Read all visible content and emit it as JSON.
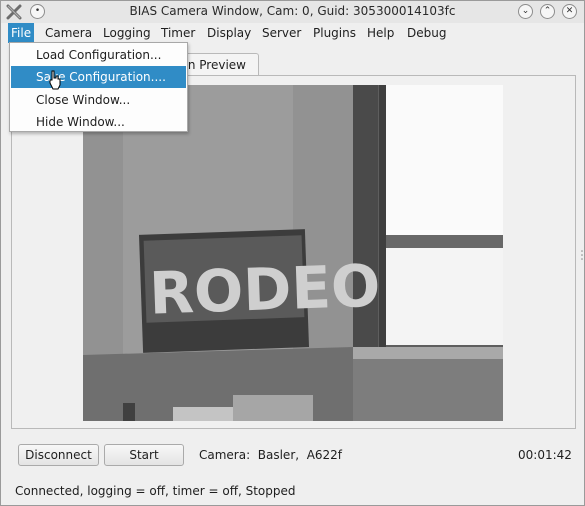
{
  "window": {
    "title": "BIAS Camera Window, Cam: 0, Guid: 305300014103fc",
    "icon": "tools-x-icon",
    "controls": [
      "minimize-icon",
      "maximize-icon",
      "close-icon"
    ]
  },
  "menubar": {
    "items": [
      {
        "label": "File",
        "active": true
      },
      {
        "label": "Camera"
      },
      {
        "label": "Logging"
      },
      {
        "label": "Timer"
      },
      {
        "label": "Display"
      },
      {
        "label": "Server"
      },
      {
        "label": "Plugins"
      },
      {
        "label": "Help"
      },
      {
        "label": "Debug"
      }
    ]
  },
  "file_menu": {
    "items": [
      {
        "label": "Load Configuration...",
        "selected": false
      },
      {
        "label": "Save Configuration....",
        "selected": true
      },
      {
        "label": "Close Window...",
        "selected": false
      },
      {
        "label": "Hide Window...",
        "selected": false
      }
    ]
  },
  "tabs": {
    "items": [
      {
        "label": "in Preview"
      }
    ]
  },
  "preview": {
    "sign_text": "RODEO"
  },
  "controls": {
    "disconnect_label": "Disconnect",
    "start_label": "Start",
    "camera_info": "Camera:  Basler,  A622f",
    "elapsed": "00:01:42"
  },
  "status": {
    "text": "Connected, logging = off, timer = off, Stopped"
  },
  "colors": {
    "accent": "#308cc6",
    "window_bg": "#efefef"
  }
}
